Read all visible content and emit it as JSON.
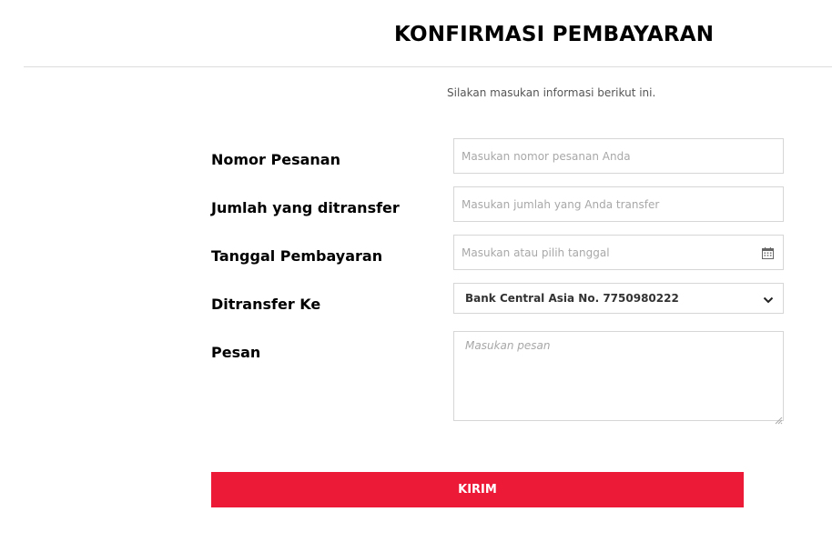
{
  "page": {
    "title": "KONFIRMASI PEMBAYARAN",
    "subtitle": "Silakan masukan informasi berikut ini."
  },
  "form": {
    "order_number": {
      "label": "Nomor Pesanan",
      "placeholder": "Masukan nomor pesanan Anda",
      "value": ""
    },
    "amount": {
      "label": "Jumlah yang ditransfer",
      "placeholder": "Masukan jumlah yang Anda transfer",
      "value": ""
    },
    "payment_date": {
      "label": "Tanggal Pembayaran",
      "placeholder": "Masukan atau pilih tanggal",
      "value": "",
      "icon": "calendar-icon"
    },
    "transfer_to": {
      "label": "Ditransfer Ke",
      "selected": "Bank Central Asia No. 7750980222",
      "icon": "chevron-down-icon"
    },
    "message": {
      "label": "Pesan",
      "placeholder": "Masukan pesan",
      "value": ""
    },
    "submit_label": "KIRIM"
  },
  "colors": {
    "accent": "#ed1a37",
    "border": "#d6d6d6",
    "placeholder": "#a8a8a8"
  }
}
